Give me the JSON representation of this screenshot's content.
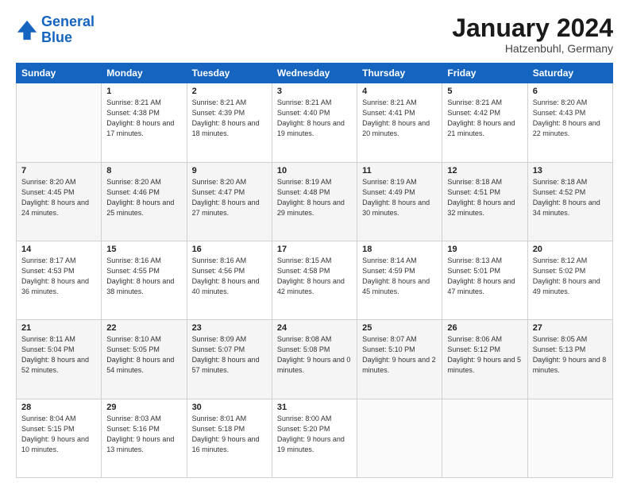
{
  "header": {
    "logo_line1": "General",
    "logo_line2": "Blue",
    "month": "January 2024",
    "location": "Hatzenbuhl, Germany"
  },
  "days_of_week": [
    "Sunday",
    "Monday",
    "Tuesday",
    "Wednesday",
    "Thursday",
    "Friday",
    "Saturday"
  ],
  "weeks": [
    [
      {
        "day": "",
        "sunrise": "",
        "sunset": "",
        "daylight": ""
      },
      {
        "day": "1",
        "sunrise": "Sunrise: 8:21 AM",
        "sunset": "Sunset: 4:38 PM",
        "daylight": "Daylight: 8 hours and 17 minutes."
      },
      {
        "day": "2",
        "sunrise": "Sunrise: 8:21 AM",
        "sunset": "Sunset: 4:39 PM",
        "daylight": "Daylight: 8 hours and 18 minutes."
      },
      {
        "day": "3",
        "sunrise": "Sunrise: 8:21 AM",
        "sunset": "Sunset: 4:40 PM",
        "daylight": "Daylight: 8 hours and 19 minutes."
      },
      {
        "day": "4",
        "sunrise": "Sunrise: 8:21 AM",
        "sunset": "Sunset: 4:41 PM",
        "daylight": "Daylight: 8 hours and 20 minutes."
      },
      {
        "day": "5",
        "sunrise": "Sunrise: 8:21 AM",
        "sunset": "Sunset: 4:42 PM",
        "daylight": "Daylight: 8 hours and 21 minutes."
      },
      {
        "day": "6",
        "sunrise": "Sunrise: 8:20 AM",
        "sunset": "Sunset: 4:43 PM",
        "daylight": "Daylight: 8 hours and 22 minutes."
      }
    ],
    [
      {
        "day": "7",
        "sunrise": "Sunrise: 8:20 AM",
        "sunset": "Sunset: 4:45 PM",
        "daylight": "Daylight: 8 hours and 24 minutes."
      },
      {
        "day": "8",
        "sunrise": "Sunrise: 8:20 AM",
        "sunset": "Sunset: 4:46 PM",
        "daylight": "Daylight: 8 hours and 25 minutes."
      },
      {
        "day": "9",
        "sunrise": "Sunrise: 8:20 AM",
        "sunset": "Sunset: 4:47 PM",
        "daylight": "Daylight: 8 hours and 27 minutes."
      },
      {
        "day": "10",
        "sunrise": "Sunrise: 8:19 AM",
        "sunset": "Sunset: 4:48 PM",
        "daylight": "Daylight: 8 hours and 29 minutes."
      },
      {
        "day": "11",
        "sunrise": "Sunrise: 8:19 AM",
        "sunset": "Sunset: 4:49 PM",
        "daylight": "Daylight: 8 hours and 30 minutes."
      },
      {
        "day": "12",
        "sunrise": "Sunrise: 8:18 AM",
        "sunset": "Sunset: 4:51 PM",
        "daylight": "Daylight: 8 hours and 32 minutes."
      },
      {
        "day": "13",
        "sunrise": "Sunrise: 8:18 AM",
        "sunset": "Sunset: 4:52 PM",
        "daylight": "Daylight: 8 hours and 34 minutes."
      }
    ],
    [
      {
        "day": "14",
        "sunrise": "Sunrise: 8:17 AM",
        "sunset": "Sunset: 4:53 PM",
        "daylight": "Daylight: 8 hours and 36 minutes."
      },
      {
        "day": "15",
        "sunrise": "Sunrise: 8:16 AM",
        "sunset": "Sunset: 4:55 PM",
        "daylight": "Daylight: 8 hours and 38 minutes."
      },
      {
        "day": "16",
        "sunrise": "Sunrise: 8:16 AM",
        "sunset": "Sunset: 4:56 PM",
        "daylight": "Daylight: 8 hours and 40 minutes."
      },
      {
        "day": "17",
        "sunrise": "Sunrise: 8:15 AM",
        "sunset": "Sunset: 4:58 PM",
        "daylight": "Daylight: 8 hours and 42 minutes."
      },
      {
        "day": "18",
        "sunrise": "Sunrise: 8:14 AM",
        "sunset": "Sunset: 4:59 PM",
        "daylight": "Daylight: 8 hours and 45 minutes."
      },
      {
        "day": "19",
        "sunrise": "Sunrise: 8:13 AM",
        "sunset": "Sunset: 5:01 PM",
        "daylight": "Daylight: 8 hours and 47 minutes."
      },
      {
        "day": "20",
        "sunrise": "Sunrise: 8:12 AM",
        "sunset": "Sunset: 5:02 PM",
        "daylight": "Daylight: 8 hours and 49 minutes."
      }
    ],
    [
      {
        "day": "21",
        "sunrise": "Sunrise: 8:11 AM",
        "sunset": "Sunset: 5:04 PM",
        "daylight": "Daylight: 8 hours and 52 minutes."
      },
      {
        "day": "22",
        "sunrise": "Sunrise: 8:10 AM",
        "sunset": "Sunset: 5:05 PM",
        "daylight": "Daylight: 8 hours and 54 minutes."
      },
      {
        "day": "23",
        "sunrise": "Sunrise: 8:09 AM",
        "sunset": "Sunset: 5:07 PM",
        "daylight": "Daylight: 8 hours and 57 minutes."
      },
      {
        "day": "24",
        "sunrise": "Sunrise: 8:08 AM",
        "sunset": "Sunset: 5:08 PM",
        "daylight": "Daylight: 9 hours and 0 minutes."
      },
      {
        "day": "25",
        "sunrise": "Sunrise: 8:07 AM",
        "sunset": "Sunset: 5:10 PM",
        "daylight": "Daylight: 9 hours and 2 minutes."
      },
      {
        "day": "26",
        "sunrise": "Sunrise: 8:06 AM",
        "sunset": "Sunset: 5:12 PM",
        "daylight": "Daylight: 9 hours and 5 minutes."
      },
      {
        "day": "27",
        "sunrise": "Sunrise: 8:05 AM",
        "sunset": "Sunset: 5:13 PM",
        "daylight": "Daylight: 9 hours and 8 minutes."
      }
    ],
    [
      {
        "day": "28",
        "sunrise": "Sunrise: 8:04 AM",
        "sunset": "Sunset: 5:15 PM",
        "daylight": "Daylight: 9 hours and 10 minutes."
      },
      {
        "day": "29",
        "sunrise": "Sunrise: 8:03 AM",
        "sunset": "Sunset: 5:16 PM",
        "daylight": "Daylight: 9 hours and 13 minutes."
      },
      {
        "day": "30",
        "sunrise": "Sunrise: 8:01 AM",
        "sunset": "Sunset: 5:18 PM",
        "daylight": "Daylight: 9 hours and 16 minutes."
      },
      {
        "day": "31",
        "sunrise": "Sunrise: 8:00 AM",
        "sunset": "Sunset: 5:20 PM",
        "daylight": "Daylight: 9 hours and 19 minutes."
      },
      {
        "day": "",
        "sunrise": "",
        "sunset": "",
        "daylight": ""
      },
      {
        "day": "",
        "sunrise": "",
        "sunset": "",
        "daylight": ""
      },
      {
        "day": "",
        "sunrise": "",
        "sunset": "",
        "daylight": ""
      }
    ]
  ]
}
